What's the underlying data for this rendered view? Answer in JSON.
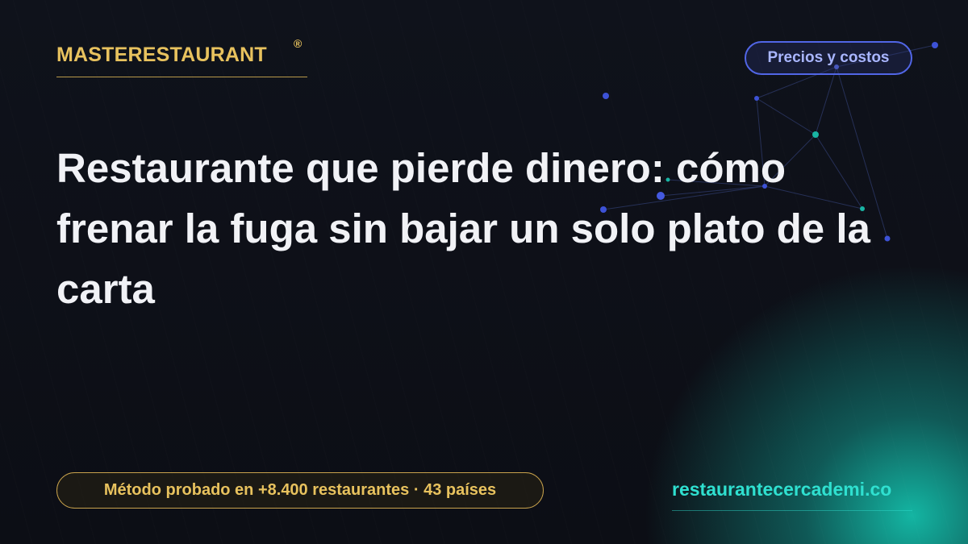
{
  "brand": {
    "name": "MASTERESTAURANT",
    "mark": "®"
  },
  "category": {
    "label": "Precios y costos"
  },
  "article": {
    "title": "Restaurante que pierde dinero: cómo frenar la fuga sin bajar un solo plato de la carta"
  },
  "proof": {
    "text": "Método probado en +8.400 restaurantes · 43 países"
  },
  "site": {
    "url": "restaurantecercademi.co"
  },
  "colors": {
    "background": "#0d0f16",
    "gold": "#e8c25e",
    "blue": "#5166e6",
    "teal": "#2fe0d0",
    "headline": "#f1f2f6"
  }
}
